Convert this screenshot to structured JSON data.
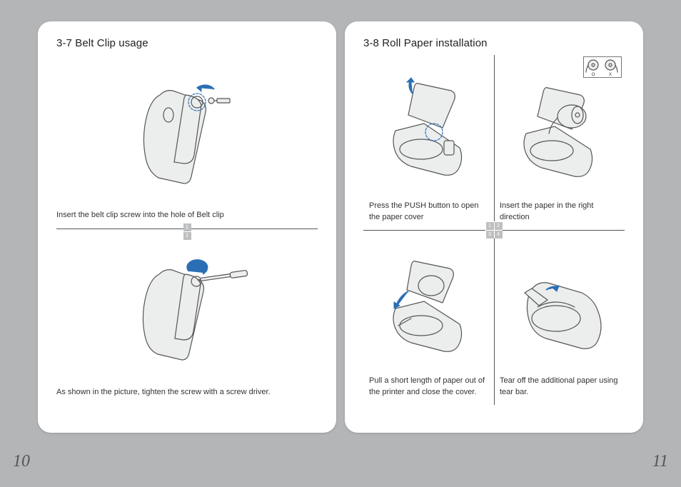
{
  "left": {
    "title": "3-7 Belt Clip usage",
    "steps": [
      {
        "caption": "Insert the belt clip screw into the hole of Belt clip"
      },
      {
        "caption": "As shown in the picture, tighten the screw with a screw driver."
      }
    ],
    "badges": [
      "1",
      "2"
    ],
    "page_number": "10"
  },
  "right": {
    "title": "3-8 Roll Paper installation",
    "cells": [
      {
        "caption": "Press the PUSH button to open the paper cover"
      },
      {
        "caption": "Insert the paper in the right direction",
        "ox": {
          "o": "O",
          "x": "X"
        }
      },
      {
        "caption": "Pull a short length of paper out of the printer and close the cover."
      },
      {
        "caption": "Tear off the additional paper using tear bar."
      }
    ],
    "badges": [
      "1",
      "2",
      "3",
      "4"
    ],
    "page_number": "11"
  }
}
